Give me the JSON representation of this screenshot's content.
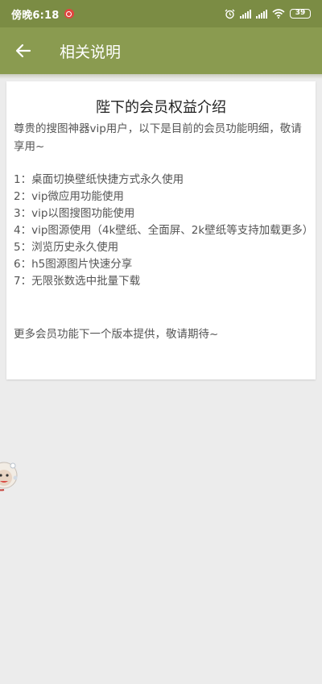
{
  "status_bar": {
    "time": "傍晚6:18",
    "battery": "39"
  },
  "header": {
    "title": "相关说明"
  },
  "card": {
    "title": "陛下的会员权益介绍",
    "intro": "尊贵的搜图神器vip用户，以下是目前的会员功能明细，敬请享用~",
    "items": [
      "1：桌面切换壁纸快捷方式永久使用",
      "2：vip微应用功能使用",
      "3：vip以图搜图功能使用",
      "4：vip图源使用（4k壁纸、全面屏、2k壁纸等支持加载更多）",
      "5：浏览历史永久使用",
      "6：h5图源图片快速分享",
      "7：无限张数选中批量下载"
    ],
    "footer": "更多会员功能下一个版本提供，敬请期待~"
  },
  "colors": {
    "status_bar": "#7b8c44",
    "app_bar": "#8a9b50",
    "background": "#ececec"
  }
}
